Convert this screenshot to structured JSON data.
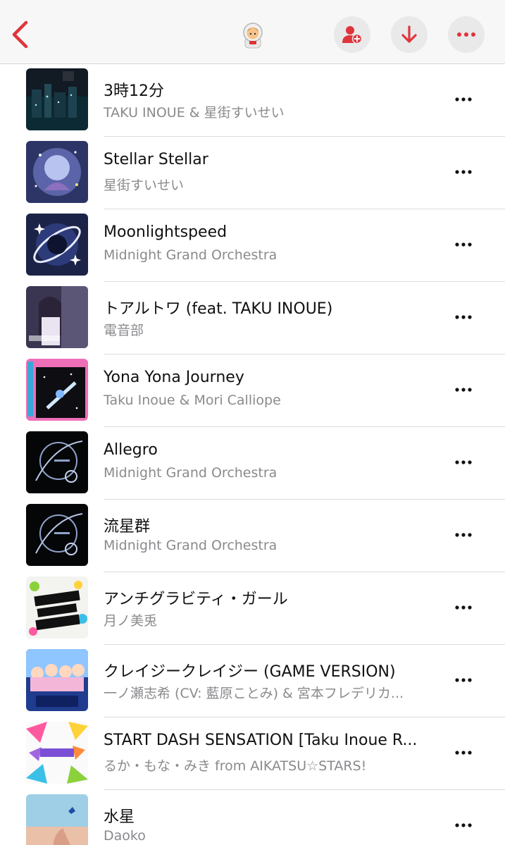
{
  "header": {
    "title_emoji": "astronaut-emoji",
    "accent_color": "#e0343c",
    "icons": {
      "back": "chevron-left-icon",
      "add_user": "person-plus-icon",
      "download": "arrow-down-icon",
      "more": "ellipsis-icon"
    }
  },
  "songs": [
    {
      "title": "3時12分",
      "artist": "TAKU INOUE & 星街すいせい"
    },
    {
      "title": "Stellar Stellar",
      "artist": "星街すいせい"
    },
    {
      "title": "Moonlightspeed",
      "artist": "Midnight Grand Orchestra"
    },
    {
      "title": "トアルトワ (feat. TAKU INOUE)",
      "artist": "電音部"
    },
    {
      "title": "Yona Yona Journey",
      "artist": "Taku Inoue & Mori Calliope"
    },
    {
      "title": "Allegro",
      "artist": "Midnight Grand Orchestra"
    },
    {
      "title": "流星群",
      "artist": "Midnight Grand Orchestra"
    },
    {
      "title": "アンチグラビティ・ガール",
      "artist": "月ノ美兎"
    },
    {
      "title": "クレイジークレイジー (GAME VERSION)",
      "artist": "一ノ瀬志希 (CV: 藍原ことみ) & 宮本フレデリカ..."
    },
    {
      "title": "START DASH SENSATION [Taku Inoue R...",
      "artist": "るか・もな・みき from AIKATSU☆STARS!"
    },
    {
      "title": "水星",
      "artist": "Daoko"
    }
  ]
}
